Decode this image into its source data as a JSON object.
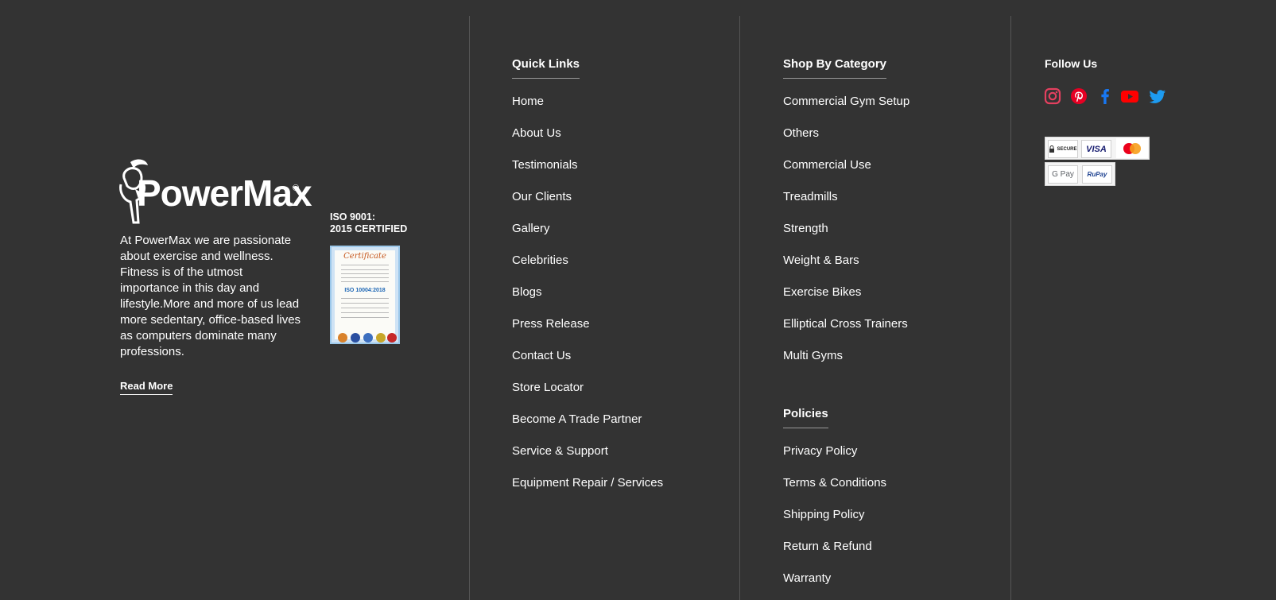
{
  "brand": {
    "logo_text": "PowerMax",
    "about_text": "At PowerMax we are passionate about exercise and wellness. Fitness is of the utmost importance in this day and lifestyle.More and more of us lead more sedentary, office-based lives as computers dominate many professions.",
    "read_more_label": "Read More"
  },
  "certification": {
    "title_line1": "ISO 9001:",
    "title_line2": "2015 CERTIFIED",
    "certificate_heading": "Certificate",
    "certificate_standard": "ISO 10004:2018"
  },
  "quick_links": {
    "heading": "Quick Links",
    "items": [
      "Home",
      "About Us",
      "Testimonials",
      "Our Clients",
      "Gallery",
      "Celebrities",
      "Blogs",
      "Press Release",
      "Contact Us",
      "Store Locator",
      "Become A Trade Partner",
      "Service & Support",
      "Equipment Repair / Services"
    ]
  },
  "shop_by_category": {
    "heading": "Shop By Category",
    "items": [
      "Commercial Gym Setup",
      "Others",
      "Commercial Use",
      "Treadmills",
      "Strength",
      "Weight & Bars",
      "Exercise Bikes",
      "Elliptical Cross Trainers",
      "Multi Gyms"
    ]
  },
  "policies": {
    "heading": "Policies",
    "items": [
      "Privacy Policy",
      "Terms & Conditions",
      "Shipping Policy",
      "Return & Refund",
      "Warranty"
    ]
  },
  "follow": {
    "heading": "Follow Us",
    "icons": [
      {
        "name": "instagram-icon",
        "color": "#e4405f"
      },
      {
        "name": "pinterest-icon",
        "color": "#e60023"
      },
      {
        "name": "facebook-icon",
        "color": "#1877f2"
      },
      {
        "name": "youtube-icon",
        "color": "#ff0000"
      },
      {
        "name": "twitter-icon",
        "color": "#1da1f2"
      }
    ]
  },
  "payments": {
    "secure_label": "SECURE",
    "visa_label": "VISA",
    "mastercard_label": "mastercard-icon",
    "gpay_label": "G Pay",
    "rupay_label": "RuPay"
  },
  "colors": {
    "background": "#333333",
    "text": "#ffffff",
    "divider": "#555555"
  }
}
